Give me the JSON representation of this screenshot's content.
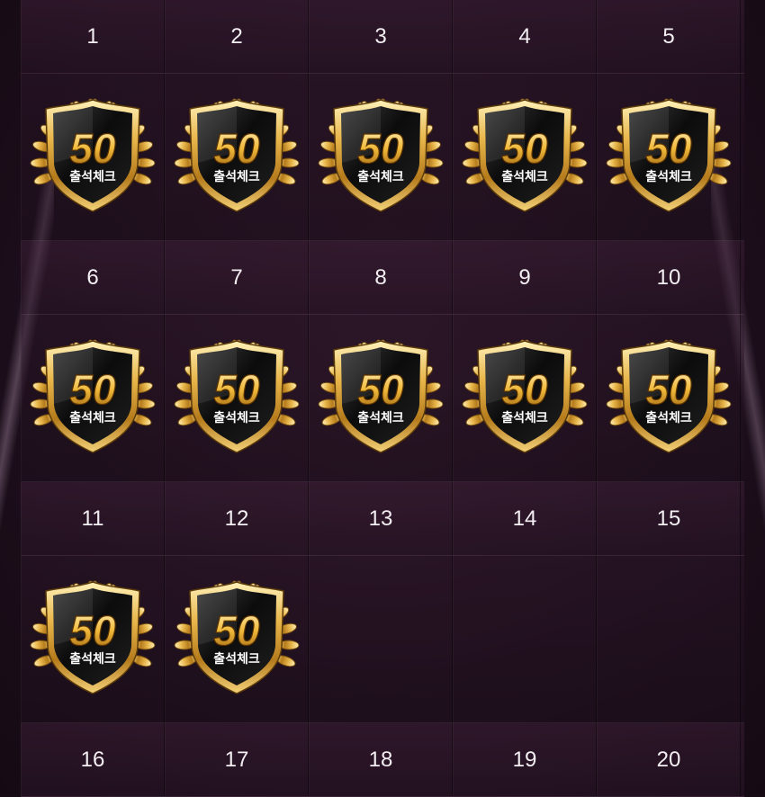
{
  "weeks": [
    {
      "days": [
        "1",
        "2",
        "3",
        "4",
        "5"
      ],
      "stamps": [
        true,
        true,
        true,
        true,
        true
      ]
    },
    {
      "days": [
        "6",
        "7",
        "8",
        "9",
        "10"
      ],
      "stamps": [
        true,
        true,
        true,
        true,
        true
      ]
    },
    {
      "days": [
        "11",
        "12",
        "13",
        "14",
        "15"
      ],
      "stamps": [
        true,
        true,
        false,
        false,
        false
      ]
    },
    {
      "days": [
        "16",
        "17",
        "18",
        "19",
        "20"
      ],
      "stamps": []
    }
  ],
  "badge": {
    "number": "50",
    "label": "출석체크",
    "icon": "attendance-badge-icon"
  },
  "colors": {
    "gold": "#e8b64a",
    "gold_dark": "#8a5a12",
    "shield": "#111111",
    "text": "#f2eef2"
  }
}
